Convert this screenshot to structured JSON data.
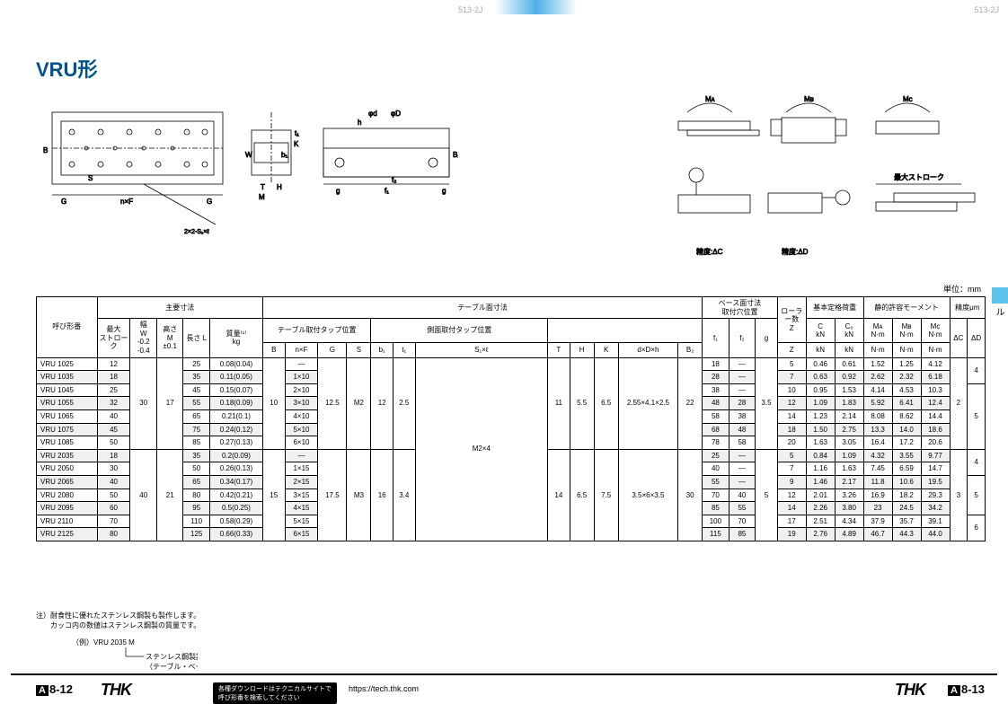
{
  "header_code": "513-2J",
  "title": "VRU形",
  "diagram_labels": {
    "left_dims": [
      "B",
      "n×F",
      "G",
      "S",
      "2×2-S₁×ℓ",
      "T",
      "M",
      "H",
      "W",
      "b₁",
      "K",
      "t₁",
      "g",
      "h",
      "φd",
      "φD",
      "f₁",
      "f₂",
      "B₂"
    ],
    "right_moments": [
      "Mᴀ",
      "Mʙ",
      "Mᴄ"
    ],
    "right_precision": [
      "精度:ΔC",
      "精度:ΔD",
      "最大ストローク"
    ]
  },
  "side_tab": "クロスローラーテーブル",
  "unit_label": "単位：mm",
  "notes": [
    "注）耐食性に優れたステンレス鋼製も製作します。",
    "　　カッコ内の数値はステンレス鋼製の質量です。"
  ],
  "example": {
    "label": "（例）VRU 2035 M",
    "line1": "ステンレス鋼製記号",
    "line2": "（テーブル・ベースはアルミ）"
  },
  "footer": {
    "page_left": "8-12",
    "page_right": "8-13",
    "page_prefix": "A",
    "logo": "THK",
    "dl_text": "各種ダウンロードはテクニカルサイトで\n呼び形番を検索してください",
    "url": "https://tech.thk.com"
  },
  "table": {
    "headers": {
      "model": "呼び形番",
      "main_dim": "主要寸法",
      "table_surface": "テーブル面寸法",
      "base_surface": "ベース面寸法\n取付穴位置",
      "basic_load": "基本定格荷重",
      "static_moment": "静的許容モーメント",
      "accuracy": "精度μm",
      "max_stroke": "最大\nストローク",
      "W": "幅\nW\n-0.2\n-0.4",
      "M": "高さ\nM\n±0.1",
      "L": "長さ\nL",
      "mass": "質量⁽¹⁾\nkg",
      "table_tap": "テーブル取付タップ位置",
      "side_tap": "側面取付タップ位置",
      "B": "B",
      "nF": "n×F",
      "G": "G",
      "S": "S",
      "b1": "b₁",
      "t1": "t₁",
      "S1l": "S₁×ℓ",
      "T": "T",
      "H": "H",
      "K": "K",
      "dDh": "d×D×h",
      "B2": "B₂",
      "f1": "f₁",
      "f2": "f₂",
      "g": "g",
      "Z": "ローラー数\nZ",
      "C": "C\nkN",
      "C0": "C₀\nkN",
      "MA": "Mᴀ\nN·m",
      "MB": "Mʙ\nN·m",
      "MC": "Mᴄ\nN·m",
      "dC": "ΔC",
      "dD": "ΔD"
    },
    "rows": [
      {
        "model": "VRU 1025",
        "stroke": "12",
        "L": "25",
        "mass": "0.08(0.04)",
        "nF": "—",
        "f1": "18",
        "f2": "—",
        "Z": "5",
        "C": "0.46",
        "C0": "0.61",
        "MA": "1.52",
        "MB": "1.25",
        "MC": "4.12",
        "shade": false
      },
      {
        "model": "VRU 1035",
        "stroke": "18",
        "L": "35",
        "mass": "0.11(0.05)",
        "nF": "1×10",
        "f1": "28",
        "f2": "—",
        "Z": "7",
        "C": "0.63",
        "C0": "0.92",
        "MA": "2.62",
        "MB": "2.32",
        "MC": "6.18",
        "shade": true
      },
      {
        "model": "VRU 1045",
        "stroke": "25",
        "L": "45",
        "mass": "0.15(0.07)",
        "nF": "2×10",
        "f1": "38",
        "f2": "—",
        "Z": "10",
        "C": "0.95",
        "C0": "1.53",
        "MA": "4.14",
        "MB": "4.53",
        "MC": "10.3",
        "shade": false
      },
      {
        "model": "VRU 1055",
        "stroke": "32",
        "L": "55",
        "mass": "0.18(0.09)",
        "nF": "3×10",
        "f1": "48",
        "f2": "28",
        "Z": "12",
        "C": "1.09",
        "C0": "1.83",
        "MA": "5.92",
        "MB": "6.41",
        "MC": "12.4",
        "shade": true
      },
      {
        "model": "VRU 1065",
        "stroke": "40",
        "L": "65",
        "mass": "0.21(0.1)",
        "nF": "4×10",
        "f1": "58",
        "f2": "38",
        "Z": "14",
        "C": "1.23",
        "C0": "2.14",
        "MA": "8.08",
        "MB": "8.62",
        "MC": "14.4",
        "shade": false
      },
      {
        "model": "VRU 1075",
        "stroke": "45",
        "L": "75",
        "mass": "0.24(0.12)",
        "nF": "5×10",
        "f1": "68",
        "f2": "48",
        "Z": "18",
        "C": "1.50",
        "C0": "2.75",
        "MA": "13.3",
        "MB": "14.0",
        "MC": "18.6",
        "shade": true
      },
      {
        "model": "VRU 1085",
        "stroke": "50",
        "L": "85",
        "mass": "0.27(0.13)",
        "nF": "6×10",
        "f1": "78",
        "f2": "58",
        "Z": "20",
        "C": "1.63",
        "C0": "3.05",
        "MA": "16.4",
        "MB": "17.2",
        "MC": "20.6",
        "shade": false
      },
      {
        "model": "VRU 2035",
        "stroke": "18",
        "L": "35",
        "mass": "0.2(0.09)",
        "nF": "—",
        "f1": "25",
        "f2": "—",
        "Z": "5",
        "C": "0.84",
        "C0": "1.09",
        "MA": "4.32",
        "MB": "3.55",
        "MC": "9.77",
        "shade": true
      },
      {
        "model": "VRU 2050",
        "stroke": "30",
        "L": "50",
        "mass": "0.26(0.13)",
        "nF": "1×15",
        "f1": "40",
        "f2": "—",
        "Z": "7",
        "C": "1.16",
        "C0": "1.63",
        "MA": "7.45",
        "MB": "6.59",
        "MC": "14.7",
        "shade": false
      },
      {
        "model": "VRU 2065",
        "stroke": "40",
        "L": "65",
        "mass": "0.34(0.17)",
        "nF": "2×15",
        "f1": "55",
        "f2": "—",
        "Z": "9",
        "C": "1.46",
        "C0": "2.17",
        "MA": "11.8",
        "MB": "10.6",
        "MC": "19.5",
        "shade": true
      },
      {
        "model": "VRU 2080",
        "stroke": "50",
        "L": "80",
        "mass": "0.42(0.21)",
        "nF": "3×15",
        "f1": "70",
        "f2": "40",
        "Z": "12",
        "C": "2.01",
        "C0": "3.26",
        "MA": "16.9",
        "MB": "18.2",
        "MC": "29.3",
        "shade": false
      },
      {
        "model": "VRU 2095",
        "stroke": "60",
        "L": "95",
        "mass": "0.5(0.25)",
        "nF": "4×15",
        "f1": "85",
        "f2": "55",
        "Z": "14",
        "C": "2.26",
        "C0": "3.80",
        "MA": "23",
        "MB": "24.5",
        "MC": "34.2",
        "shade": true
      },
      {
        "model": "VRU 2110",
        "stroke": "70",
        "L": "110",
        "mass": "0.58(0.29)",
        "nF": "5×15",
        "f1": "100",
        "f2": "70",
        "Z": "17",
        "C": "2.51",
        "C0": "4.34",
        "MA": "37.9",
        "MB": "35.7",
        "MC": "39.1",
        "shade": false
      },
      {
        "model": "VRU 2125",
        "stroke": "80",
        "L": "125",
        "mass": "0.66(0.33)",
        "nF": "6×15",
        "f1": "115",
        "f2": "85",
        "Z": "19",
        "C": "2.76",
        "C0": "4.89",
        "MA": "46.7",
        "MB": "44.3",
        "MC": "44.0",
        "shade": true
      }
    ],
    "groups": {
      "g1": {
        "W": "30",
        "M": "17",
        "B": "10",
        "G": "12.5",
        "S": "M2",
        "b1": "12",
        "t1": "2.5",
        "T": "11",
        "H": "5.5",
        "K": "6.5",
        "dDh": "2.55×4.1×2.5",
        "B2": "22",
        "g": "3.5",
        "dC": "2",
        "S1l": "M2×4"
      },
      "g2": {
        "W": "40",
        "M": "21",
        "B": "15",
        "G": "17.5",
        "S": "M3",
        "b1": "16",
        "t1": "3.4",
        "T": "14",
        "H": "6.5",
        "K": "7.5",
        "dDh": "3.5×6×3.5",
        "B2": "30",
        "g": "5",
        "dC": "3",
        "dD_g1_top": "4",
        "dD_g1_mid": "5",
        "dD_g2_top": "4",
        "dD_g2_mid": "5",
        "dD_g2_bot": "6"
      }
    }
  }
}
